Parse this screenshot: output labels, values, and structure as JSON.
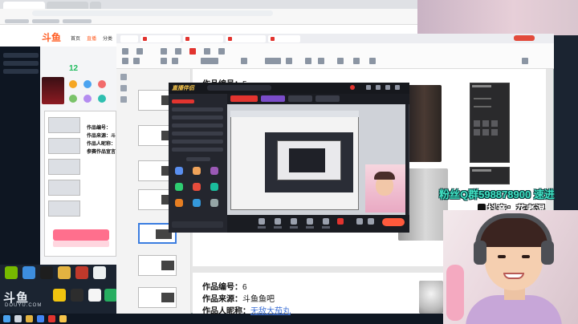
{
  "douyu": {
    "logo": "斗鱼",
    "nav": [
      "首页",
      "直播",
      "分类"
    ],
    "count": "12"
  },
  "left_doc": {
    "lines": [
      "作品编号：",
      "作品来源：斗",
      "作品人昵称：",
      "参赛作品宣言："
    ]
  },
  "main_doc": {
    "page5": {
      "id_label": "作品编号：",
      "id_value": "5"
    },
    "page6": {
      "id_label": "作品编号：",
      "id_value": "6",
      "source_label": "作品来源：",
      "source_value": "斗鱼鱼吧",
      "nick_label": "作品人昵称：",
      "nick_value": "无敌大茄丸"
    }
  },
  "stream_app": {
    "logo": "直播伴侣"
  },
  "overlay": {
    "qq_group": "粉丝Q群598878900 速进",
    "douyin": "抖音：花老湿",
    "douyin_icon": "tiktok-icon"
  },
  "watermark": {
    "logo": "斗鱼",
    "site": "DOUYU.COM"
  },
  "colors": {
    "douyu_orange": "#ff5d23",
    "overlay_cyan": "#41e0c2",
    "go_live_red": "#ff5a3c",
    "pdf_accent": "#e2342f"
  }
}
